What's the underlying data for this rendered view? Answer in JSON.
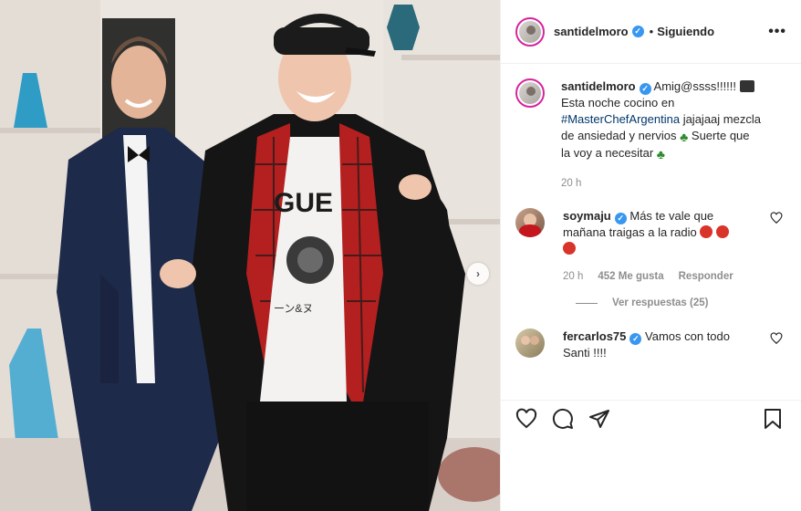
{
  "post": {
    "username": "santidelmoro",
    "follow_status": "Siguiendo",
    "more_icon": "more-options-icon"
  },
  "caption": {
    "username": "santidelmoro",
    "line1": "Amig@ssss!!!!!!",
    "line2": "Esta noche cocino en",
    "hashtag": "#MasterChefArgentina",
    "line3_rest": " jajajaaj mezcla",
    "line4": "de ansiedad y nervios",
    "line5": " Suerte que",
    "line6": "la voy a necesitar",
    "time": "20 h"
  },
  "comments": [
    {
      "username": "soymaju",
      "text1": "Más te vale que",
      "text2": "mañana traigas a la radio",
      "time": "20 h",
      "likes": "452 Me gusta",
      "reply": "Responder",
      "view_replies": "Ver respuestas (25)"
    },
    {
      "username": "fercarlos75",
      "text1": "Vamos con todo",
      "text2": "Santi !!!!"
    }
  ],
  "colors": {
    "link": "#00376b",
    "verified": "#3897f0",
    "secondary_text": "#8e8e8e",
    "story_ring": "#d6249f"
  }
}
